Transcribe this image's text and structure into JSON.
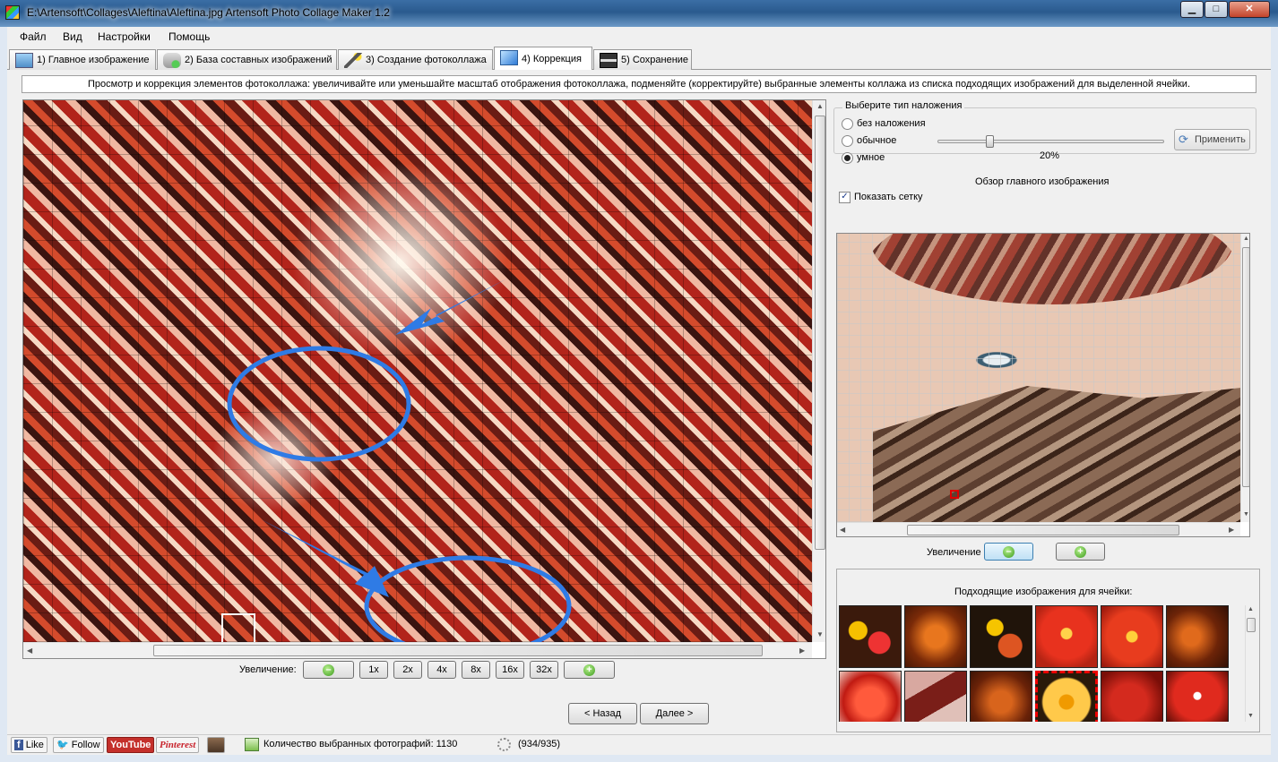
{
  "window": {
    "title": "E:\\Artensoft\\Collages\\Aleftina\\Aleftina.jpg Artensoft Photo Collage Maker 1.2",
    "minimize": "▁",
    "maximize": "□",
    "close": "✕"
  },
  "menu": [
    "Файл",
    "Вид",
    "Настройки",
    "Помощь"
  ],
  "tabs": [
    {
      "label": "1) Главное изображение",
      "icon": "picture-icon"
    },
    {
      "label": "2) База составных изображений",
      "icon": "database-icon"
    },
    {
      "label": "3) Создание фотоколлажа",
      "icon": "magic-wand-icon"
    },
    {
      "label": "4) Коррекция",
      "icon": "cube-icon",
      "active": true
    },
    {
      "label": "5) Сохранение",
      "icon": "floppy-disk-icon"
    }
  ],
  "info_text": "Просмотр и коррекция элементов фотоколлажа: увеличивайте или уменьшайте масштаб отображения фотоколлажа, подменяйте (корректируйте) выбранные элементы коллажа из списка подходящих изображений для выделенной ячейки.",
  "mosaic_zoom": {
    "label": "Увеличение:",
    "minus": "–",
    "levels": [
      "1x",
      "2x",
      "4x",
      "8x",
      "16x",
      "32x"
    ],
    "plus": "+"
  },
  "overlay": {
    "title": "Выберите тип наложения",
    "options": [
      "без наложения",
      "обычное",
      "умное"
    ],
    "selected": "умное",
    "percent_text": "20%",
    "level": 0.2,
    "apply": "Применить"
  },
  "preview": {
    "title": "Обзор главного изображения",
    "show_grid": "Показать сетку",
    "zoom_label": "Увеличение"
  },
  "candidates": {
    "title": "Подходящие изображения для ячейки:"
  },
  "nav": {
    "back": "< Назад",
    "next": "Далее >"
  },
  "status": {
    "like": "Like",
    "follow": "Follow",
    "youtube": "YouTube",
    "pinterest": "Pinterest",
    "selected_count": "Количество выбранных фотографий: 1130",
    "progress": "(934/935)"
  },
  "colors": {
    "accent": "#2f7be5",
    "selection": "#e00000"
  }
}
